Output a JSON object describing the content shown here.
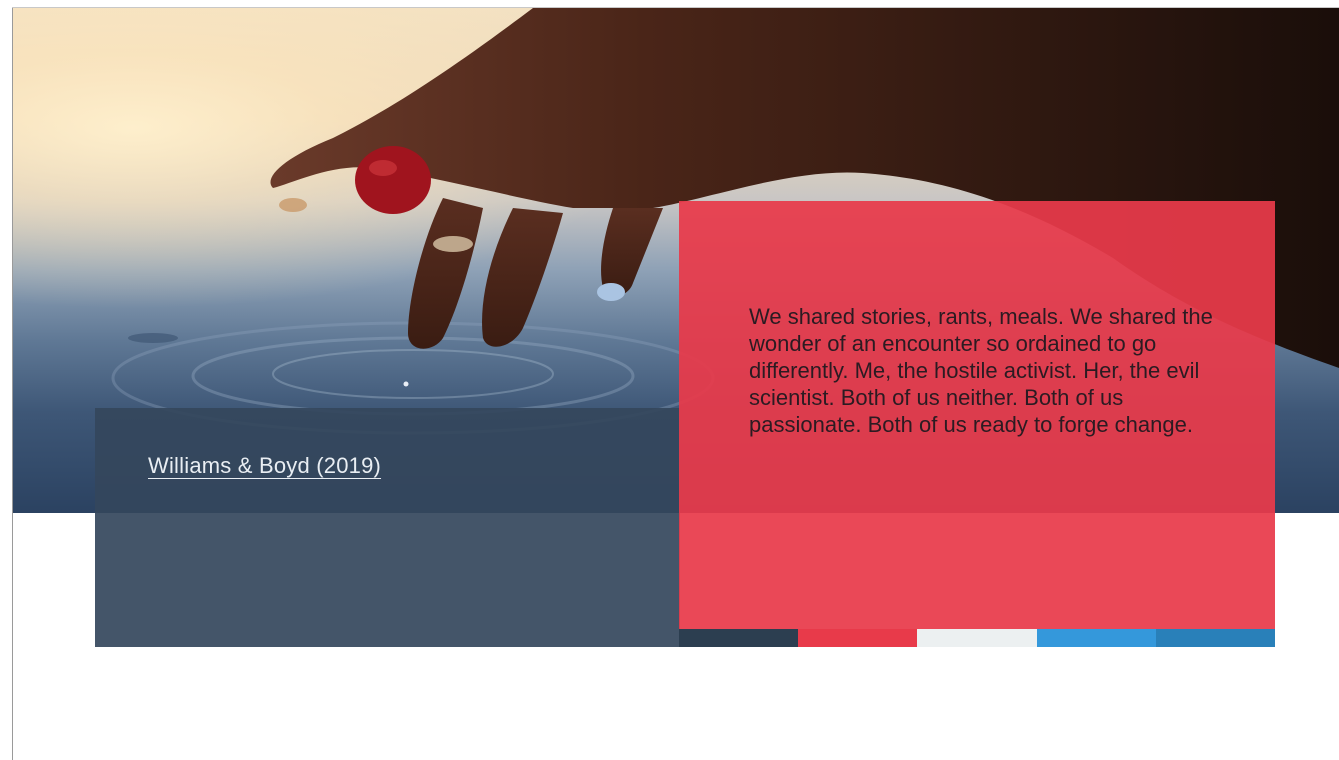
{
  "citation": {
    "link_text": "Williams & Boyd (2019)"
  },
  "quote": {
    "text": "We shared stories, rants, meals. We shared the wonder of an encounter so ordained to go differently. Me, the hostile activist. Her, the evil scientist. Both of us neither. Both of us passionate. Both of us ready to forge change."
  },
  "colors": {
    "caption_panel": "#34465c",
    "quote_panel": "#e83a4a",
    "stripe": [
      "#2c3e50",
      "#e83a4a",
      "#ecf0f1",
      "#3498db",
      "#2980b9"
    ]
  },
  "hero": {
    "image": "hand-touching-water-photo"
  }
}
